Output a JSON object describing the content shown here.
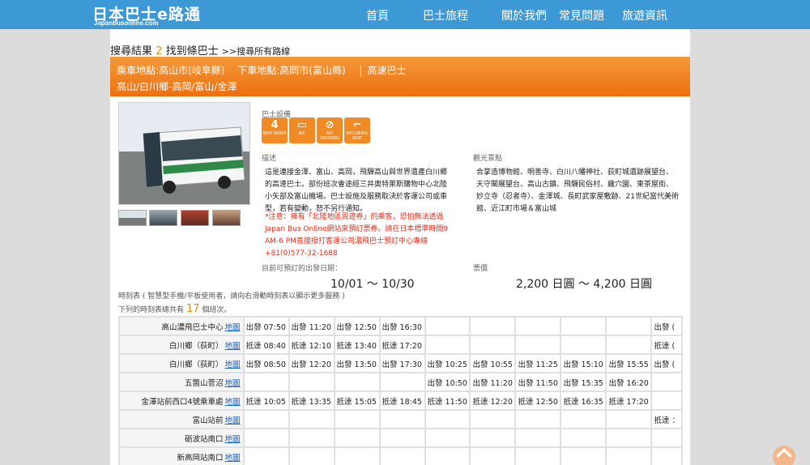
{
  "header": {
    "logo_main": "日本巴士e路通",
    "logo_sub": "Japanbusonline.com",
    "nav": [
      "首頁",
      "巴士旅程",
      "關於我們",
      "常見問題",
      "旅遊資訊"
    ]
  },
  "results": {
    "prefix": "搜尋結果",
    "count": "2",
    "suffix": "找到條巴士",
    "all_routes": ">>搜尋所有路線"
  },
  "route": {
    "boarding": "乘車地點:高山市(岐阜縣)",
    "alighting": "下車地點:高岡市(富山縣)",
    "type": "高速巴士",
    "stops": "高山/白川鄉-高岡/富山/金澤"
  },
  "equipment": {
    "label": "巴士設備",
    "items": [
      {
        "icon": "4",
        "caption": "SEAT ROWS"
      },
      {
        "icon": "▭",
        "caption": "A/C"
      },
      {
        "icon": "⊘",
        "caption": "NO SMOKING"
      },
      {
        "icon": "⌐",
        "caption": "RECLINING SEAT"
      }
    ]
  },
  "description": {
    "label": "描述",
    "text": "這是連接金澤、富山、高岡，飛驒高山與世界遺產白川鄉的高速巴士。部份班次會途經三井奧特萊斯購物中心北陸小矢部及富山機場。巴士設施及服務取決於客運公司或車型，若有變動，恕不另行通知。",
    "warning": "*注意：擁有「北陸地區周遊券」的乘客，恐怕無法透過Japan Bus Online網站來預訂票券。請在日本標準時間9 AM-6 PM直接撥打客運公司濃飛巴士預訂中心專線 +81(0)577-32-1688"
  },
  "sights": {
    "label": "觀光景點",
    "text": "合掌造博物館、明善寺、白川八幡神社、荻町城遺跡展望台、天守閣展望台、高山古鎮、飛驒民俗村、雞穴園、東茶屋街、妙立寺（忍者寺）、金澤城、長町武家屋敷跡、21世紀當代美術館、近江町市場＆富山城"
  },
  "booking": {
    "date_label": "目前可預訂的出發日期：",
    "date_range": "10/01 〜 10/30",
    "fare_label": "票價",
    "fare_range": "2,200 日圓 〜 4,200 日圓"
  },
  "timetable": {
    "note": "時刻表 ( 智慧型手機/平板使用者，請向右滑動時刻表以顯示更多服務 )",
    "total_prefix": "下列的時刻表總共有",
    "total": "17",
    "total_suffix": "個班次。",
    "map_label": "地圖",
    "rows": [
      {
        "station": "高山濃飛巴士中心",
        "cells": [
          "出發 07:50",
          "出發 11:20",
          "出發 12:50",
          "出發 16:30",
          "",
          "",
          "",
          "",
          "",
          "出發 ("
        ]
      },
      {
        "station": "白川鄉（荻町）",
        "cells": [
          "抵達 08:40",
          "抵達 12:10",
          "抵達 13:40",
          "抵達 17:20",
          "",
          "",
          "",
          "",
          "",
          "抵達 ("
        ]
      },
      {
        "station": "白川鄉（荻町）",
        "cells": [
          "出發 08:50",
          "出發 12:20",
          "出發 13:50",
          "出發 17:30",
          "出發 10:25",
          "出發 10:55",
          "出發 11:25",
          "出發 15:10",
          "出發 15:55",
          "出發 ("
        ]
      },
      {
        "station": "五箇山菅沼",
        "cells": [
          "",
          "",
          "",
          "",
          "出發 10:50",
          "出發 11:20",
          "出發 11:50",
          "出發 15:35",
          "出發 16:20",
          ""
        ]
      },
      {
        "station": "金澤站前西口4號乘車處",
        "cells": [
          "抵達 10:05",
          "抵達 13:35",
          "抵達 15:05",
          "抵達 18:45",
          "抵達 11:50",
          "抵達 12:20",
          "抵達 12:50",
          "抵達 16:35",
          "抵達 17:20",
          ""
        ]
      },
      {
        "station": "富山站前",
        "cells": [
          "",
          "",
          "",
          "",
          "",
          "",
          "",
          "",
          "",
          "抵達 ："
        ]
      },
      {
        "station": "砺波站南口",
        "cells": [
          "",
          "",
          "",
          "",
          "",
          "",
          "",
          "",
          "",
          ""
        ]
      },
      {
        "station": "新高岡站南口",
        "cells": [
          "",
          "",
          "",
          "",
          "",
          "",
          "",
          "",
          "",
          ""
        ]
      }
    ]
  }
}
